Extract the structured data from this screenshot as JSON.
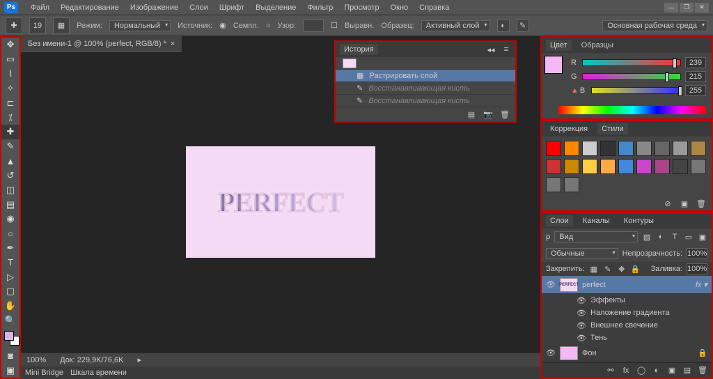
{
  "app_logo": "Ps",
  "menus": [
    "Файл",
    "Редактирование",
    "Изображение",
    "Слои",
    "Шрифт",
    "Выделение",
    "Фильтр",
    "Просмотр",
    "Окно",
    "Справка"
  ],
  "options_bar": {
    "brush_size": "19",
    "mode_label": "Режим:",
    "mode_val": "Нормальный",
    "source_label": "Источник:",
    "sample_label": "Семпл.",
    "pattern_label": "Узор:",
    "aligned_label": "Выравн.",
    "sample_label2": "Образец:",
    "sample_val": "Активный слой",
    "workspace": "Основная рабочая среда"
  },
  "doc_tab": "Без имени-1 @ 100% (perfect, RGB/8) *",
  "canvas_text": "PERFECT",
  "status": {
    "zoom": "100%",
    "doc": "Док: 229,9K/76,6K"
  },
  "bottom_tabs": [
    "Mini Bridge",
    "Шкала времени"
  ],
  "history": {
    "tab": "История",
    "rows": [
      {
        "label": "Растрировать слой",
        "sel": true
      },
      {
        "label": "Восстанавливающая кисть",
        "sel": false
      },
      {
        "label": "Восстанавливающая кисть",
        "sel": false
      }
    ]
  },
  "color": {
    "tabs": [
      "Цвет",
      "Образцы"
    ],
    "r": {
      "lab": "R",
      "val": "239",
      "pos": "92%"
    },
    "g": {
      "lab": "G",
      "val": "215",
      "pos": "84%"
    },
    "b": {
      "lab": "B",
      "val": "255",
      "pos": "98%"
    }
  },
  "styles": {
    "tabs": [
      "Коррекция",
      "Стили"
    ],
    "swatches": [
      "#ff0000",
      "#ff8800",
      "#cccccc",
      "#333333",
      "#4488cc",
      "#888888",
      "#666666",
      "#999999",
      "#aa8844",
      "#cc3333",
      "#cc8800",
      "#ffcc44",
      "#ffaa44",
      "#4488dd",
      "#cc44cc",
      "#aa4488",
      "#444444",
      "#777777",
      "#777777",
      "#777777"
    ]
  },
  "layers": {
    "tabs": [
      "Слои",
      "Каналы",
      "Контуры"
    ],
    "kind_label": "Вид",
    "blend": "Обычные",
    "opacity_label": "Непрозрачность:",
    "opacity": "100%",
    "lock_label": "Закрепить:",
    "fill_label": "Заливка:",
    "fill": "100%",
    "items": [
      {
        "name": "perfect",
        "sel": true,
        "fx": true
      },
      {
        "name": "Фон",
        "sel": false,
        "locked": true
      }
    ],
    "fx_label": "Эффекты",
    "fx_items": [
      "Наложение градиента",
      "Внешнее свечение",
      "Тень"
    ]
  }
}
